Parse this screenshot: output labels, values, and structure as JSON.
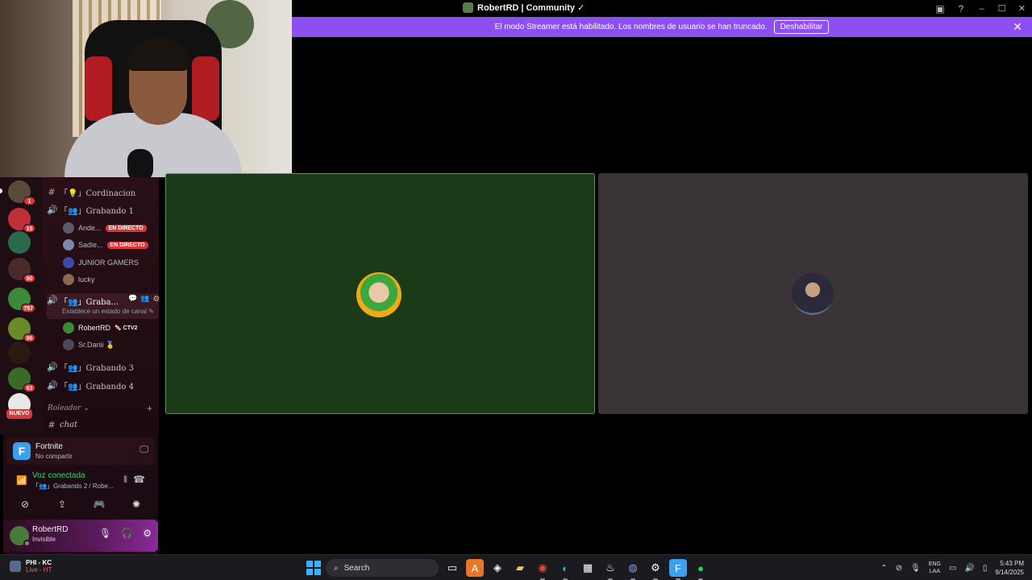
{
  "window": {
    "title": "RobertRD | Community ✓",
    "controls": {
      "minimize": "–",
      "maximize": "☐",
      "close": "✕"
    }
  },
  "banner": {
    "text": "El modo Streamer está habilitado. Los nombres de usuario se han truncado.",
    "button": "Deshabilitar",
    "close": "✕"
  },
  "servers": {
    "badges": [
      "1",
      "15",
      "90",
      "757",
      "86",
      "63"
    ],
    "new_label": "NUEVO"
  },
  "channels": {
    "items": [
      {
        "icon": "#",
        "label": "「💡」Cordinacion"
      },
      {
        "icon": "🔊",
        "label": "「👥」Grabando 1"
      },
      {
        "icon": "🔊",
        "label": "「👥」Graba..."
      },
      {
        "icon": "🔊",
        "label": "「👥」Grabando 3"
      },
      {
        "icon": "🔊",
        "label": "「👥」Grabando 4"
      },
      {
        "icon": "#",
        "label": "chat"
      }
    ],
    "members_1": [
      {
        "name": "Ande...",
        "badge": "EN DIRECTO"
      },
      {
        "name": "Sadie...",
        "badge": "EN DIRECTO"
      },
      {
        "name": "JUNIOR GAMERS",
        "badge": ""
      },
      {
        "name": "lucky",
        "badge": ""
      }
    ],
    "members_2": [
      {
        "name": "RobertRD",
        "badge": "🍬 CTV2"
      },
      {
        "name": "Sr.Dariii 🥇",
        "badge": ""
      }
    ],
    "status_hint": "Establece un estado de canal ✎",
    "category": "Roleador ⌄",
    "category_add": "+"
  },
  "activity": {
    "icon_letter": "F",
    "game": "Fortnite",
    "sub": "No compartir"
  },
  "voice": {
    "title": "Voz conectada",
    "sub": "「👥」Grabando 2 / Robe..."
  },
  "user": {
    "name": "RobertRD",
    "status": "Invisible"
  },
  "taskbar": {
    "weather_title": "PHI - KC",
    "weather_sub": "Live - HT",
    "search_label": "Search",
    "lang_1": "ENG",
    "lang_2": "LAA",
    "time": "5:43 PM",
    "date": "9/14/2025"
  }
}
